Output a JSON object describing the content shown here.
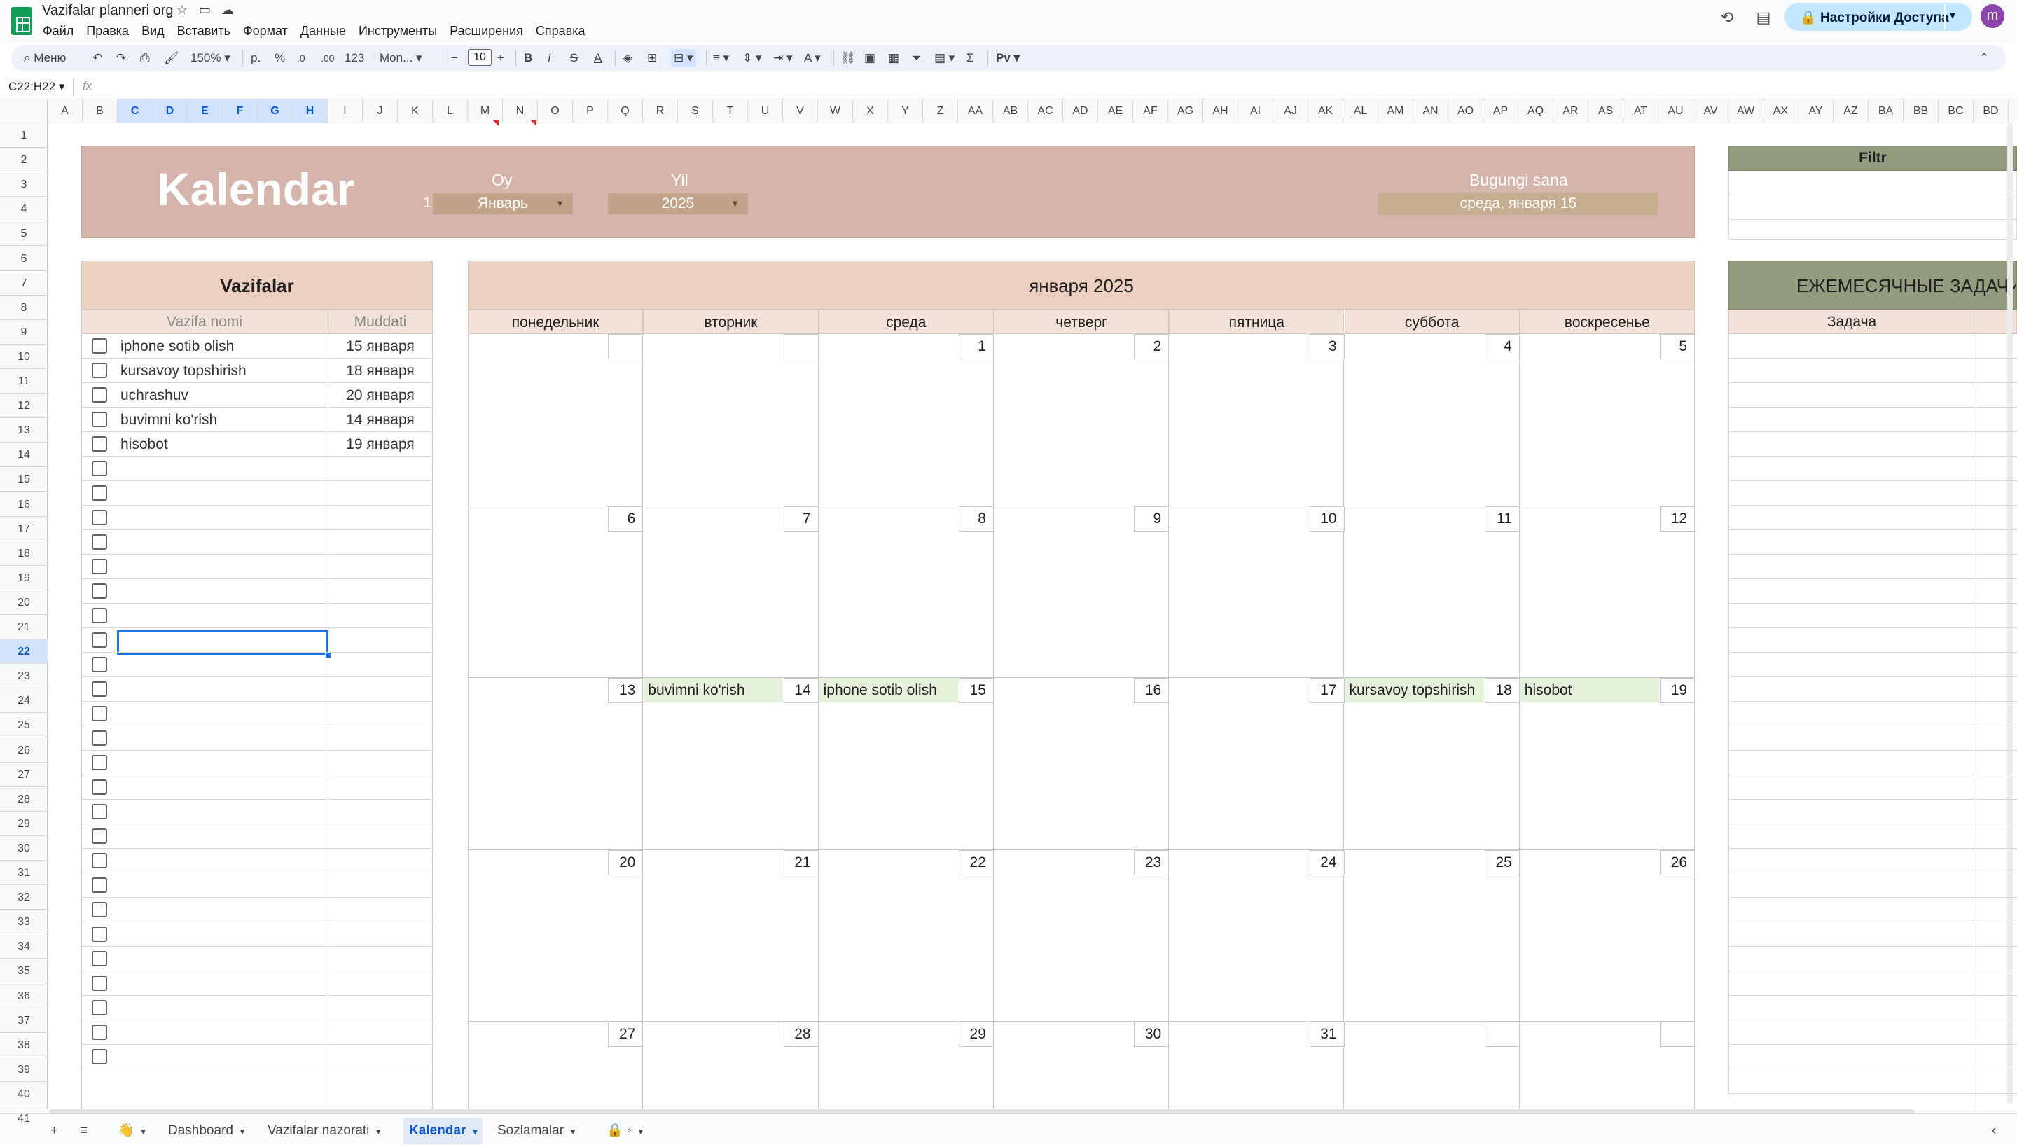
{
  "app": {
    "title": "Vazifalar planneri org",
    "menu": [
      "Файл",
      "Правка",
      "Вид",
      "Вставить",
      "Формат",
      "Данные",
      "Инструменты",
      "Расширения",
      "Справка"
    ],
    "share_label": "Настройки Доступа",
    "avatar_letter": "m"
  },
  "toolbar": {
    "menu_search": "Меню",
    "zoom": "150%",
    "currency": "р.",
    "percent": "%",
    "dec_minus": ".0",
    "dec_plus": ".00",
    "number_format": "123",
    "font": "Mon...",
    "font_size": "10",
    "script_label": "Рv"
  },
  "formula": {
    "name_box": "C22:H22",
    "fx": "fx"
  },
  "columns": [
    "A",
    "B",
    "C",
    "D",
    "E",
    "F",
    "G",
    "H",
    "I",
    "J",
    "K",
    "L",
    "M",
    "N",
    "O",
    "P",
    "Q",
    "R",
    "S",
    "T",
    "U",
    "V",
    "W",
    "X",
    "Y",
    "Z",
    "AA",
    "AB",
    "AC",
    "AD",
    "AE",
    "AF",
    "AG",
    "AH",
    "AI",
    "AJ",
    "AK",
    "AL",
    "AM",
    "AN",
    "AO",
    "AP",
    "AQ",
    "AR",
    "AS",
    "AT",
    "AU",
    "AV",
    "AW",
    "AX",
    "AY",
    "AZ",
    "BA",
    "BB",
    "BC",
    "BD"
  ],
  "selected_columns": [
    "C",
    "D",
    "E",
    "F",
    "G",
    "H"
  ],
  "rows_count": 41,
  "selected_row": 22,
  "banner": {
    "title": "Kalendar",
    "month_label": "Oy",
    "month_value": "Январь",
    "month_index": "1",
    "year_label": "Yil",
    "year_value": "2025",
    "today_label": "Bugungi sana",
    "today_value": "среда, января 15"
  },
  "filter": {
    "label": "Filtr"
  },
  "tasks": {
    "title": "Vazifalar",
    "col_name": "Vazifa nomi",
    "col_due": "Muddati",
    "items": [
      {
        "name": "iphone sotib olish",
        "due": "15 января"
      },
      {
        "name": "kursavoy topshirish",
        "due": "18 января"
      },
      {
        "name": "uchrashuv",
        "due": "20 января"
      },
      {
        "name": "buvimni ko'rish",
        "due": "14 января"
      },
      {
        "name": "hisobot",
        "due": "19 января"
      }
    ]
  },
  "calendar": {
    "title": "января 2025",
    "weekdays": [
      "понедельник",
      "вторник",
      "среда",
      "четверг",
      "пятница",
      "суббота",
      "воскресенье"
    ],
    "weeks": [
      [
        "",
        "",
        "1",
        "2",
        "3",
        "4",
        "5"
      ],
      [
        "6",
        "7",
        "8",
        "9",
        "10",
        "11",
        "12"
      ],
      [
        "13",
        "14",
        "15",
        "16",
        "17",
        "18",
        "19"
      ],
      [
        "20",
        "21",
        "22",
        "23",
        "24",
        "25",
        "26"
      ],
      [
        "27",
        "28",
        "29",
        "30",
        "31",
        "",
        ""
      ]
    ],
    "events": [
      {
        "week": 2,
        "day": 1,
        "text": "buvimni ko'rish"
      },
      {
        "week": 2,
        "day": 2,
        "text": "iphone sotib olish"
      },
      {
        "week": 2,
        "day": 5,
        "text": "kursavoy topshirish"
      },
      {
        "week": 2,
        "day": 6,
        "text": "hisobot"
      }
    ]
  },
  "monthly": {
    "title": "ЕЖЕМЕСЯЧНЫЕ ЗАДАЧИ",
    "col_task": "Задача"
  },
  "sheet_tabs": [
    "Dashboard",
    "Vazifalar nazorati",
    "Kalendar",
    "Sozlamalar"
  ],
  "active_tab": "Kalendar",
  "colors": {
    "banner": "#d5b4ab",
    "header_peach": "#ecd0c0",
    "olive": "#939c7e",
    "event_green": "#e6f1dc",
    "accent": "#0b57d0"
  }
}
